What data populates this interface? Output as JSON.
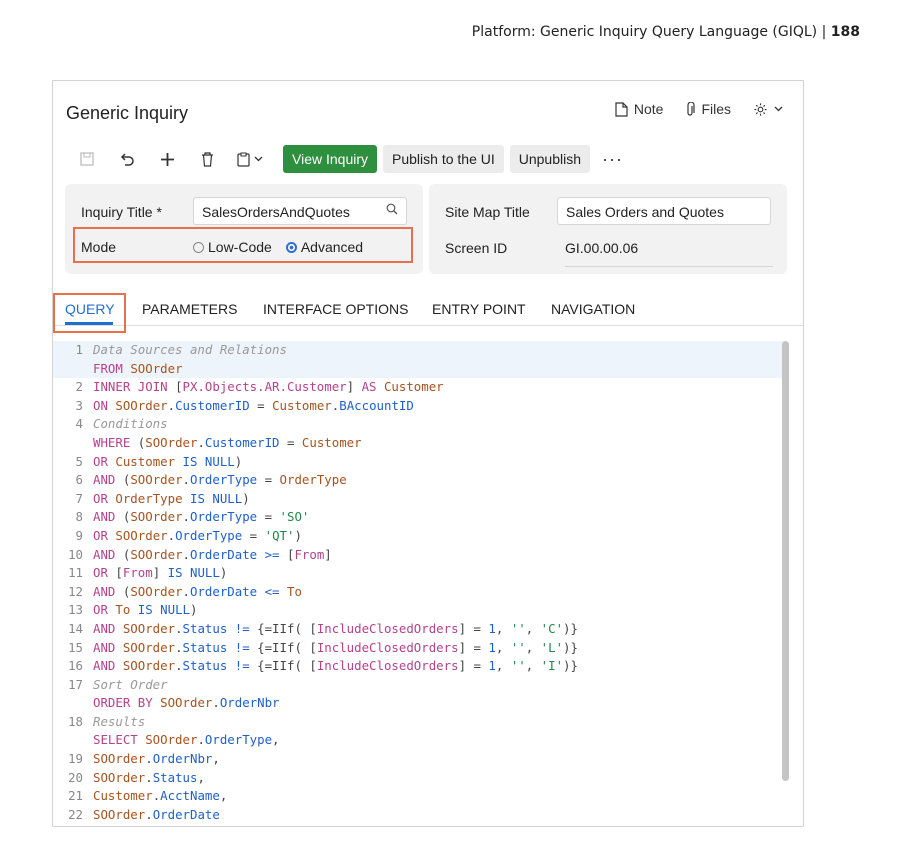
{
  "page_header": {
    "text": "Platform: Generic Inquiry Query Language (GIQL) | ",
    "page": "188"
  },
  "window": {
    "title": "Generic Inquiry",
    "actions": {
      "note": "Note",
      "files": "Files"
    }
  },
  "toolbar": {
    "view_inquiry": "View Inquiry",
    "publish": "Publish to the UI",
    "unpublish": "Unpublish",
    "more": "···"
  },
  "form": {
    "inquiry_title_label": "Inquiry Title *",
    "inquiry_title_value": "SalesOrdersAndQuotes",
    "mode_label": "Mode",
    "mode_options": [
      "Low-Code",
      "Advanced"
    ],
    "mode_selected": "Advanced",
    "site_map_title_label": "Site Map Title",
    "site_map_title_value": "Sales Orders and Quotes",
    "screen_id_label": "Screen ID",
    "screen_id_value": "GI.00.00.06"
  },
  "tabs": [
    "QUERY",
    "PARAMETERS",
    "INTERFACE OPTIONS",
    "ENTRY POINT",
    "NAVIGATION"
  ],
  "active_tab": "QUERY",
  "colors": {
    "accent": "#2e8f3f",
    "tab_active": "#1e6fd0",
    "highlight_box": "#e8704d"
  },
  "code_lines": [
    {
      "n": "1",
      "hl": true,
      "t": [
        [
          "c",
          "Data Sources and Relations"
        ]
      ]
    },
    {
      "n": "",
      "hl": true,
      "t": [
        [
          "k",
          "FROM "
        ],
        [
          "id",
          "SOOrder"
        ]
      ]
    },
    {
      "n": "2",
      "t": [
        [
          "k",
          "INNER JOIN "
        ],
        [
          "p",
          "["
        ],
        [
          "k",
          "PX.Objects.AR.Customer"
        ],
        [
          "p",
          "] "
        ],
        [
          "k",
          "AS "
        ],
        [
          "id",
          "Customer"
        ]
      ]
    },
    {
      "n": "3",
      "t": [
        [
          "k",
          "ON "
        ],
        [
          "id",
          "SOOrder"
        ],
        [
          "p",
          "."
        ],
        [
          "b",
          "CustomerID"
        ],
        [
          "p",
          " = "
        ],
        [
          "id",
          "Customer"
        ],
        [
          "p",
          "."
        ],
        [
          "b",
          "BAccountID"
        ]
      ]
    },
    {
      "n": "4",
      "t": [
        [
          "c",
          "Conditions"
        ]
      ]
    },
    {
      "n": "",
      "t": [
        [
          "k",
          "WHERE "
        ],
        [
          "p",
          "("
        ],
        [
          "id",
          "SOOrder"
        ],
        [
          "p",
          "."
        ],
        [
          "b",
          "CustomerID"
        ],
        [
          "p",
          " = "
        ],
        [
          "id",
          "Customer"
        ]
      ]
    },
    {
      "n": "5",
      "t": [
        [
          "k",
          "OR "
        ],
        [
          "id",
          "Customer"
        ],
        [
          "b",
          " IS NULL"
        ],
        [
          "p",
          ")"
        ]
      ]
    },
    {
      "n": "6",
      "t": [
        [
          "k",
          "AND "
        ],
        [
          "p",
          "("
        ],
        [
          "id",
          "SOOrder"
        ],
        [
          "p",
          "."
        ],
        [
          "b",
          "OrderType"
        ],
        [
          "p",
          " = "
        ],
        [
          "id",
          "OrderType"
        ]
      ]
    },
    {
      "n": "7",
      "t": [
        [
          "k",
          "OR "
        ],
        [
          "id",
          "OrderType"
        ],
        [
          "b",
          " IS NULL"
        ],
        [
          "p",
          ")"
        ]
      ]
    },
    {
      "n": "8",
      "t": [
        [
          "k",
          "AND "
        ],
        [
          "p",
          "("
        ],
        [
          "id",
          "SOOrder"
        ],
        [
          "p",
          "."
        ],
        [
          "b",
          "OrderType"
        ],
        [
          "p",
          " = "
        ],
        [
          "s",
          "'SO'"
        ]
      ]
    },
    {
      "n": "9",
      "t": [
        [
          "k",
          "OR "
        ],
        [
          "id",
          "SOOrder"
        ],
        [
          "p",
          "."
        ],
        [
          "b",
          "OrderType"
        ],
        [
          "p",
          " = "
        ],
        [
          "s",
          "'QT'"
        ],
        [
          "p",
          ")"
        ]
      ]
    },
    {
      "n": "10",
      "t": [
        [
          "k",
          "AND "
        ],
        [
          "p",
          "("
        ],
        [
          "id",
          "SOOrder"
        ],
        [
          "p",
          "."
        ],
        [
          "b",
          "OrderDate"
        ],
        [
          "b",
          " >= "
        ],
        [
          "p",
          "["
        ],
        [
          "k",
          "From"
        ],
        [
          "p",
          "]"
        ]
      ]
    },
    {
      "n": "11",
      "t": [
        [
          "k",
          "OR "
        ],
        [
          "p",
          "["
        ],
        [
          "k",
          "From"
        ],
        [
          "p",
          "]"
        ],
        [
          "b",
          " IS NULL"
        ],
        [
          "p",
          ")"
        ]
      ]
    },
    {
      "n": "12",
      "t": [
        [
          "k",
          "AND "
        ],
        [
          "p",
          "("
        ],
        [
          "id",
          "SOOrder"
        ],
        [
          "p",
          "."
        ],
        [
          "b",
          "OrderDate"
        ],
        [
          "b",
          " <= "
        ],
        [
          "id",
          "To"
        ]
      ]
    },
    {
      "n": "13",
      "t": [
        [
          "k",
          "OR "
        ],
        [
          "id",
          "To"
        ],
        [
          "b",
          " IS NULL"
        ],
        [
          "p",
          ")"
        ]
      ]
    },
    {
      "n": "14",
      "t": [
        [
          "k",
          "AND "
        ],
        [
          "id",
          "SOOrder"
        ],
        [
          "p",
          "."
        ],
        [
          "b",
          "Status"
        ],
        [
          "b",
          " != "
        ],
        [
          "p",
          "{=IIf( ["
        ],
        [
          "k",
          "IncludeClosedOrders"
        ],
        [
          "p",
          "] = "
        ],
        [
          "b",
          "1"
        ],
        [
          "p",
          ", "
        ],
        [
          "s",
          "''"
        ],
        [
          "p",
          ", "
        ],
        [
          "s",
          "'C'"
        ],
        [
          "p",
          ")}"
        ]
      ]
    },
    {
      "n": "15",
      "t": [
        [
          "k",
          "AND "
        ],
        [
          "id",
          "SOOrder"
        ],
        [
          "p",
          "."
        ],
        [
          "b",
          "Status"
        ],
        [
          "b",
          " != "
        ],
        [
          "p",
          "{=IIf( ["
        ],
        [
          "k",
          "IncludeClosedOrders"
        ],
        [
          "p",
          "] = "
        ],
        [
          "b",
          "1"
        ],
        [
          "p",
          ", "
        ],
        [
          "s",
          "''"
        ],
        [
          "p",
          ", "
        ],
        [
          "s",
          "'L'"
        ],
        [
          "p",
          ")}"
        ]
      ]
    },
    {
      "n": "16",
      "t": [
        [
          "k",
          "AND "
        ],
        [
          "id",
          "SOOrder"
        ],
        [
          "p",
          "."
        ],
        [
          "b",
          "Status"
        ],
        [
          "b",
          " != "
        ],
        [
          "p",
          "{=IIf( ["
        ],
        [
          "k",
          "IncludeClosedOrders"
        ],
        [
          "p",
          "] = "
        ],
        [
          "b",
          "1"
        ],
        [
          "p",
          ", "
        ],
        [
          "s",
          "''"
        ],
        [
          "p",
          ", "
        ],
        [
          "s",
          "'I'"
        ],
        [
          "p",
          ")}"
        ]
      ]
    },
    {
      "n": "17",
      "t": [
        [
          "c",
          "Sort Order"
        ]
      ]
    },
    {
      "n": "",
      "t": [
        [
          "k",
          "ORDER BY "
        ],
        [
          "id",
          "SOOrder"
        ],
        [
          "p",
          "."
        ],
        [
          "b",
          "OrderNbr"
        ]
      ]
    },
    {
      "n": "18",
      "t": [
        [
          "c",
          "Results"
        ]
      ]
    },
    {
      "n": "",
      "t": [
        [
          "k",
          "SELECT "
        ],
        [
          "id",
          "SOOrder"
        ],
        [
          "p",
          "."
        ],
        [
          "b",
          "OrderType"
        ],
        [
          "p",
          ","
        ]
      ]
    },
    {
      "n": "19",
      "t": [
        [
          "id",
          "SOOrder"
        ],
        [
          "p",
          "."
        ],
        [
          "b",
          "OrderNbr"
        ],
        [
          "p",
          ","
        ]
      ]
    },
    {
      "n": "20",
      "t": [
        [
          "id",
          "SOOrder"
        ],
        [
          "p",
          "."
        ],
        [
          "b",
          "Status"
        ],
        [
          "p",
          ","
        ]
      ]
    },
    {
      "n": "21",
      "t": [
        [
          "id",
          "Customer"
        ],
        [
          "p",
          "."
        ],
        [
          "b",
          "AcctName"
        ],
        [
          "p",
          ","
        ]
      ]
    },
    {
      "n": "22",
      "t": [
        [
          "id",
          "SOOrder"
        ],
        [
          "p",
          "."
        ],
        [
          "b",
          "OrderDate"
        ]
      ]
    }
  ]
}
